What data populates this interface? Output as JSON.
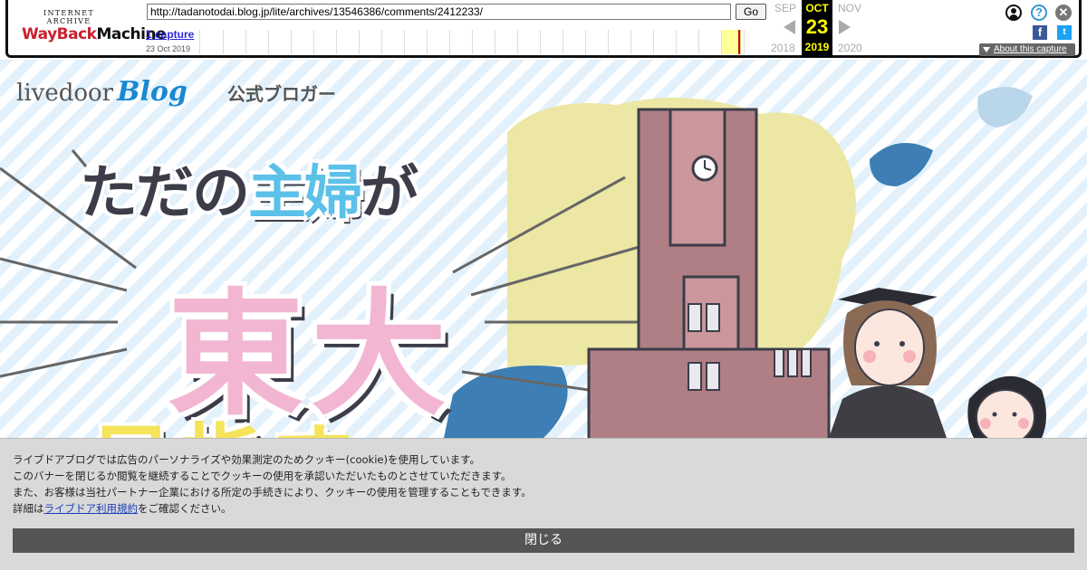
{
  "wayback": {
    "logo_top": "INTERNET ARCHIVE",
    "logo_wayback": "WayBack",
    "logo_machine": "Machine",
    "url": "http://tadanotodai.blog.jp/lite/archives/13546386/comments/2412233/",
    "go_label": "Go",
    "captures_label": "1 capture",
    "capture_date": "23 Oct 2019",
    "prev_month": "SEP",
    "prev_year": "2018",
    "current_month": "OCT",
    "current_day": "23",
    "current_year": "2019",
    "next_month": "NOV",
    "next_year": "2020",
    "about_label": "About this capture",
    "help_glyph": "?",
    "close_glyph": "✕",
    "facebook_glyph": "f",
    "twitter_glyph": "t",
    "colors": {
      "current_bg": "#000000",
      "current_fg": "#ffff00",
      "capture_mark": "#bb1111"
    }
  },
  "hero": {
    "brand_livedoor": "livedoor",
    "brand_blog": "Blog",
    "brand_sub": "公式ブロガー",
    "line1_pre": "ただの",
    "line1_accent": "主婦",
    "line1_post": "が",
    "line2": "東大",
    "line3": "目指す"
  },
  "cookie": {
    "line1": "ライブドアブログでは広告のパーソナライズや効果測定のためクッキー(cookie)を使用しています。",
    "line2": "このバナーを閉じるか閲覧を継続することでクッキーの使用を承認いただいたものとさせていただきます。",
    "line3": "また、お客様は当社パートナー企業における所定の手続きにより、クッキーの使用を管理することもできます。",
    "line4_pre": "詳細は",
    "line4_link": "ライブドア利用規約",
    "line4_post": "をご確認ください。",
    "close_label": "閉じる"
  }
}
